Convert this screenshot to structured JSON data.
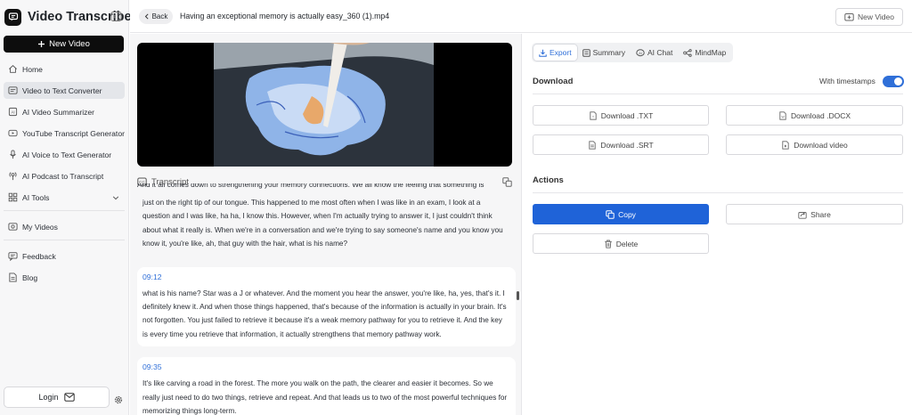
{
  "sidebar": {
    "brand": "Video Transcriber",
    "new_video": "New Video",
    "items": [
      {
        "label": "Home"
      },
      {
        "label": "Video to Text Converter"
      },
      {
        "label": "AI Video Summarizer"
      },
      {
        "label": "YouTube Transcript Generator"
      },
      {
        "label": "AI Voice to Text Generator"
      },
      {
        "label": "AI Podcast to Transcript"
      },
      {
        "label": "AI Tools"
      }
    ],
    "items2": [
      {
        "label": "My Videos"
      }
    ],
    "items3": [
      {
        "label": "Feedback"
      },
      {
        "label": "Blog"
      }
    ],
    "login": "Login"
  },
  "topbar": {
    "back": "Back",
    "file_title": "Having an exceptional memory is actually easy_360 (1).mp4",
    "new_video": "New Video"
  },
  "transcript": {
    "header": "Transcript",
    "partial_top": "And it all comes down to strengthening your memory connections. We all know the feeling that something is",
    "segments": [
      {
        "time": "",
        "text": "just on the right tip of our tongue. This happened to me most often when I was like in an exam, I look at a question and I was like, ha ha, I know this. However, when I'm actually trying to answer it, I just couldn't think about what it really is. When we're in a conversation and we're trying to say someone's name and you know you know it, you're like, ah, that guy with the hair, what is his name?"
      },
      {
        "time": "09:12",
        "text": "what is his name? Star was a J or whatever. And the moment you hear the answer, you're like, ha, yes, that's it. I definitely knew it. And when those things happened, that's because of the information is actually in your brain. It's not forgotten. You just failed to retrieve it because it's a weak memory pathway for you to retrieve it. And the key is every time you retrieve that information, it actually strengthens that memory pathway work."
      },
      {
        "time": "09:35",
        "text": "It's like carving a road in the forest. The more you walk on the path, the clearer and easier it becomes. So we really just need to do two things, retrieve and repeat. And that leads us to two of the most powerful techniques for memorizing things long-term."
      }
    ]
  },
  "panel": {
    "tabs": [
      "Export",
      "Summary",
      "AI Chat",
      "MindMap"
    ],
    "download_title": "Download",
    "with_timestamps": "With timestamps",
    "timestamps_on": true,
    "download_txt": "Download .TXT",
    "download_docx": "Download .DOCX",
    "download_srt": "Download .SRT",
    "download_video": "Download video",
    "actions_title": "Actions",
    "copy": "Copy",
    "share": "Share",
    "delete": "Delete"
  },
  "colors": {
    "accent": "#1f63d8",
    "timestamp": "#2f6fd8"
  }
}
